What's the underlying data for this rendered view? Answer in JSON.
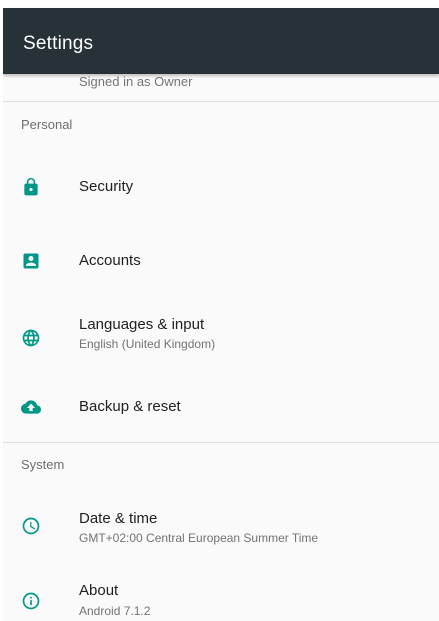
{
  "appbar": {
    "title": "Settings",
    "background": "#263238"
  },
  "partial_row": {
    "text": "Signed in as Owner"
  },
  "sections": {
    "personal": {
      "header": "Personal",
      "items": {
        "security": {
          "title": "Security",
          "icon": "lock-icon"
        },
        "accounts": {
          "title": "Accounts",
          "icon": "account-box-icon"
        },
        "languages": {
          "title": "Languages & input",
          "summary": "English (United Kingdom)",
          "icon": "globe-icon"
        },
        "backup": {
          "title": "Backup & reset",
          "icon": "cloud-upload-icon"
        }
      }
    },
    "system": {
      "header": "System",
      "items": {
        "datetime": {
          "title": "Date & time",
          "summary": "GMT+02:00 Central European Summer Time",
          "icon": "clock-icon"
        },
        "about": {
          "title": "About",
          "summary": "Android 7.1.2",
          "icon": "info-icon"
        }
      }
    }
  },
  "colors": {
    "accent": "#009688",
    "text_primary": "#212121",
    "text_secondary": "#737373",
    "divider": "#e0e0e0"
  }
}
